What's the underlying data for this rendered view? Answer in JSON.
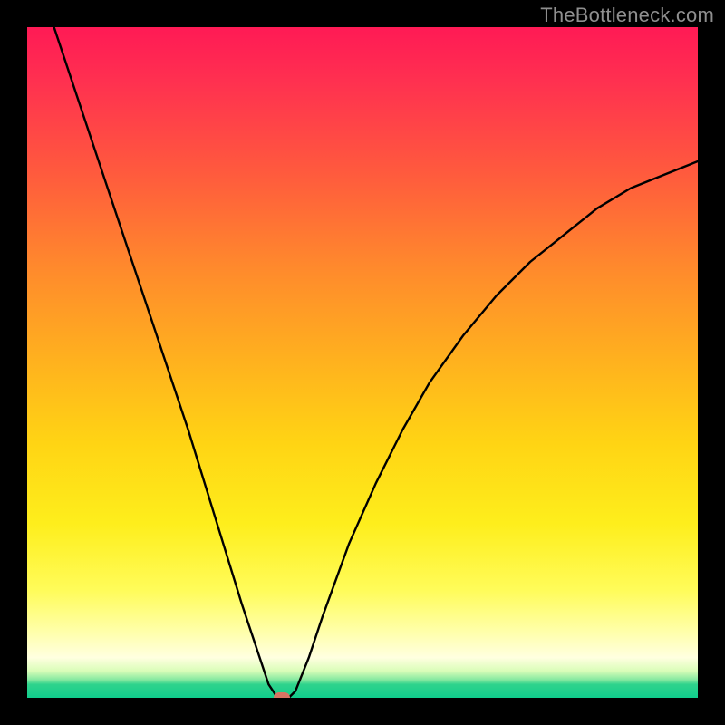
{
  "watermark": {
    "text": "TheBottleneck.com"
  },
  "chart_data": {
    "type": "line",
    "title": "",
    "xlabel": "",
    "ylabel": "",
    "xlim": [
      0,
      100
    ],
    "ylim": [
      0,
      100
    ],
    "background_gradient_vertical": [
      {
        "pct": 0,
        "color": "#ff1a55"
      },
      {
        "pct": 8,
        "color": "#ff3050"
      },
      {
        "pct": 22,
        "color": "#ff5b3d"
      },
      {
        "pct": 36,
        "color": "#ff8a2c"
      },
      {
        "pct": 50,
        "color": "#ffb21e"
      },
      {
        "pct": 62,
        "color": "#ffd414"
      },
      {
        "pct": 74,
        "color": "#feee1c"
      },
      {
        "pct": 84,
        "color": "#fffc5a"
      },
      {
        "pct": 90,
        "color": "#ffffa8"
      },
      {
        "pct": 94,
        "color": "#ffffe0"
      },
      {
        "pct": 96,
        "color": "#d9fdb8"
      },
      {
        "pct": 97.3,
        "color": "#85e8a0"
      },
      {
        "pct": 98,
        "color": "#2fd38c"
      },
      {
        "pct": 100,
        "color": "#10cd8c"
      }
    ],
    "series": [
      {
        "name": "bottleneck-curve",
        "color": "#000000",
        "x": [
          4,
          8,
          12,
          16,
          20,
          24,
          28,
          32,
          34,
          36,
          37,
          38,
          39,
          40,
          42,
          44,
          48,
          52,
          56,
          60,
          65,
          70,
          75,
          80,
          85,
          90,
          95,
          100
        ],
        "y": [
          100,
          88,
          76,
          64,
          52,
          40,
          27,
          14,
          8,
          2,
          0.5,
          0,
          0,
          1,
          6,
          12,
          23,
          32,
          40,
          47,
          54,
          60,
          65,
          69,
          73,
          76,
          78,
          80
        ]
      }
    ],
    "minimum_marker": {
      "x": 38,
      "y": 0,
      "color": "#d77463"
    }
  }
}
